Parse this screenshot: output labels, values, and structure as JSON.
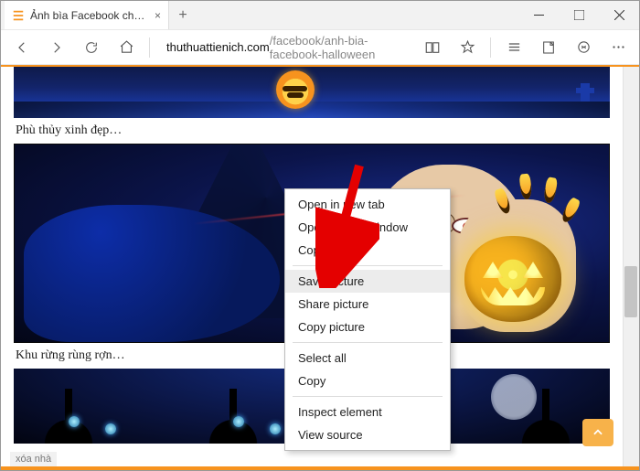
{
  "window": {
    "tab_title": "Ảnh bìa Facebook chủ đ",
    "minimize": "–",
    "maximize": "□",
    "close": "×",
    "newtab": "+"
  },
  "toolbar": {
    "url_host": "thuthuattienich.com",
    "url_path": "/facebook/anh-bia-facebook-halloween"
  },
  "page": {
    "caption1": "Phù thủy xinh đẹp…",
    "caption2": "Khu rừng rùng rợn…",
    "overlay_text": "xóa nhà"
  },
  "contextmenu": {
    "items": [
      "Open in new tab",
      "Open in new window",
      "Copy link",
      "__sep__",
      "Save picture",
      "Share picture",
      "Copy picture",
      "__sep__",
      "Select all",
      "Copy",
      "__sep__",
      "Inspect element",
      "View source"
    ],
    "highlighted": "Save picture"
  },
  "scrolltop_label": "^"
}
